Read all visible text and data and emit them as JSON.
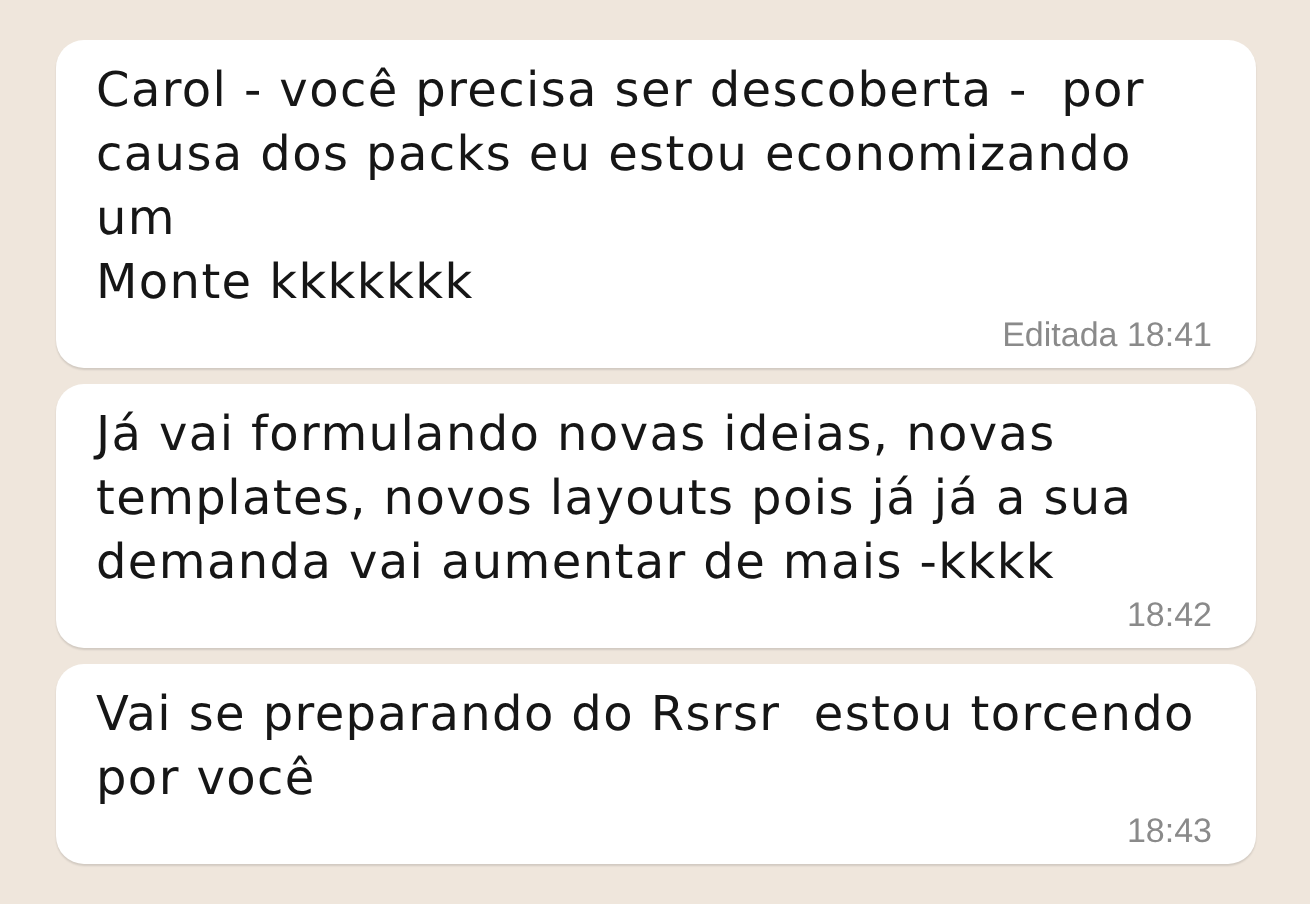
{
  "messages": [
    {
      "text": "Carol - você precisa ser descoberta -  por causa dos packs eu estou economizando um\nMonte kkkkkkk",
      "edited_label": "Editada",
      "time": "18:41"
    },
    {
      "text": "Já vai formulando novas ideias, novas templates, novos layouts pois já já a sua demanda vai aumentar de mais -kkkk",
      "time": "18:42"
    },
    {
      "text": "Vai se preparando do Rsrsr  estou torcendo por você",
      "time": "18:43"
    }
  ]
}
